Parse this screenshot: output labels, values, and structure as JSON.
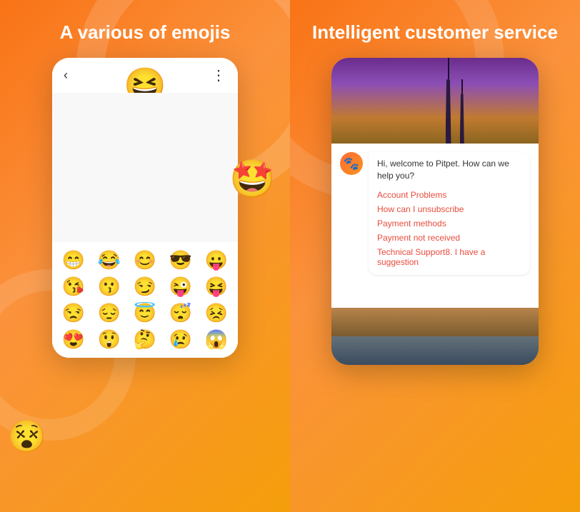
{
  "left": {
    "title": "A various of emojis",
    "phone": {
      "back_icon": "‹",
      "menu_icon": "⋮"
    },
    "emojis": {
      "hero": "😆",
      "floating_1": "🤩",
      "floating_2": "😵",
      "grid": [
        "😁",
        "😂",
        "😊",
        "😎",
        "😛",
        "😘",
        "😗",
        "😏",
        "😜",
        "😝",
        "😒",
        "😔",
        "😇",
        "😴",
        "😣",
        "😍",
        "😲",
        "🤔",
        "😢",
        "😱"
      ]
    }
  },
  "right": {
    "title": "Intelligent customer service",
    "chat": {
      "welcome_text": "Hi, welcome to Pitpet. How can we help you?",
      "options": [
        "Account Problems",
        "How can I unsubscribe",
        "Payment methods",
        "Payment not received",
        "Technical Support8. I have a suggestion"
      ]
    }
  }
}
